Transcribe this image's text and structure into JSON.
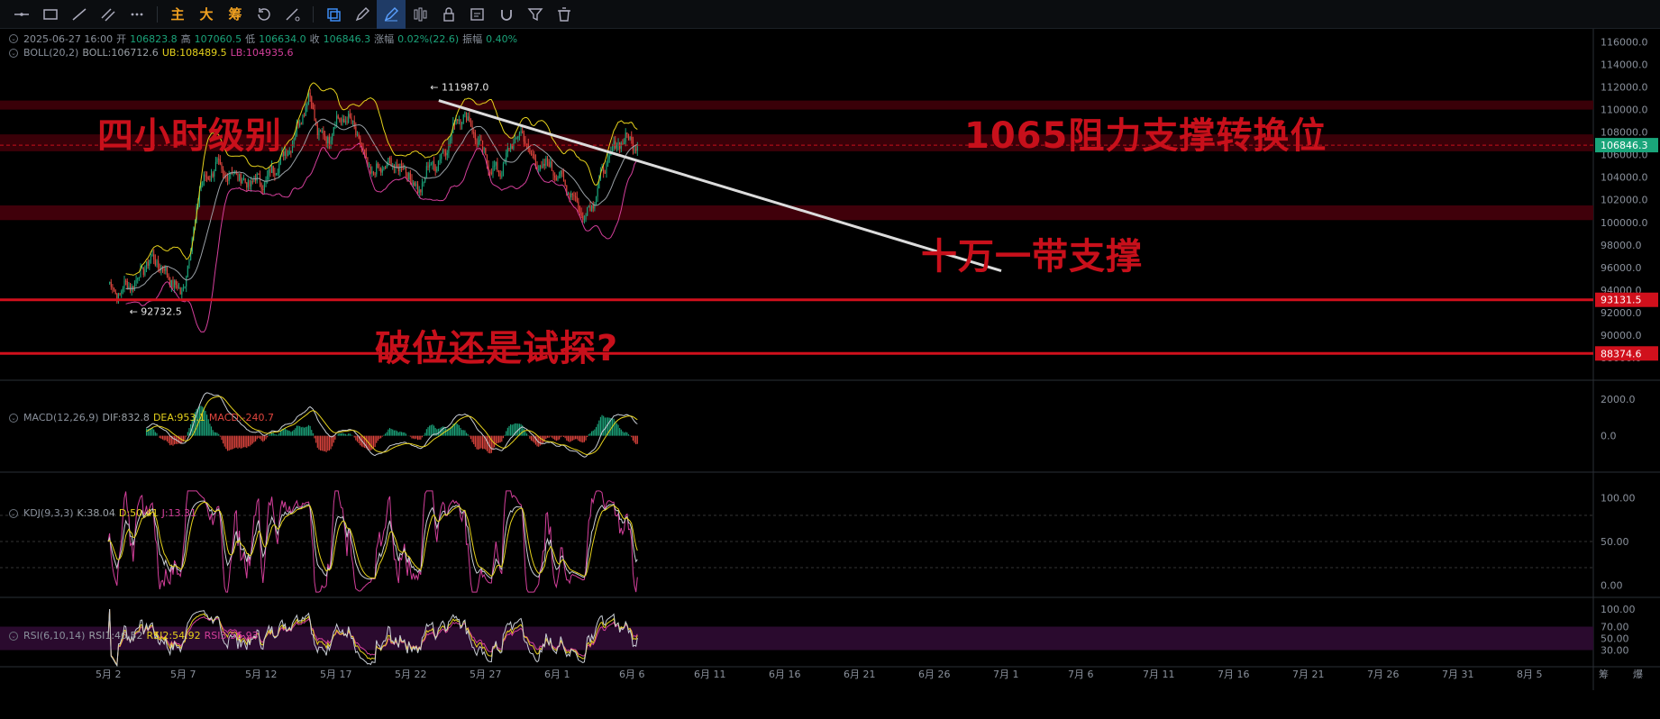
{
  "toolbar": {
    "tools": [
      "horizontal-line-icon",
      "rectangle-icon",
      "trend-line-icon",
      "parallel-line-icon",
      "more-icon"
    ],
    "text_buttons": [
      "主",
      "大",
      "筹"
    ],
    "right_tools": [
      "layers-icon",
      "pencil-icon",
      "pen-icon",
      "bars-icon",
      "lock-icon",
      "edit-icon",
      "magnet-icon",
      "filter-icon",
      "trash-icon"
    ]
  },
  "legends": {
    "main": {
      "date": "2025-06-27 16:00",
      "open_label": "开",
      "open": "106823.8",
      "high_label": "高",
      "high": "107060.5",
      "low_label": "低",
      "low": "106634.0",
      "close_label": "收",
      "close": "106846.3",
      "change_label": "涨幅",
      "change": "0.02%(22.6)",
      "amp_label": "振幅",
      "amp": "0.40%"
    },
    "boll": {
      "name": "BOLL(20,2)",
      "mid": "BOLL:106712.6",
      "ub": "UB:108489.5",
      "lb": "LB:104935.6"
    },
    "macd": {
      "name": "MACD(12,26,9)",
      "dif": "DIF:832.8",
      "dea": "DEA:953.1",
      "macd": "MACD:-240.7"
    },
    "kdj": {
      "name": "KDJ(9,3,3)",
      "k": "K:38.04",
      "d": "D:50.41",
      "j": "J:13.31"
    },
    "rsi": {
      "name": "RSI(6,10,14)",
      "rsi1": "RSI1:46.52",
      "rsi2": "RSI2:54.92",
      "rsi3": "RSI3:56.93"
    }
  },
  "annotations": {
    "title": "四小时级别",
    "resistance": "1065阻力支撑转换位",
    "support": "十万一带支撑",
    "question": "破位还是试探?"
  },
  "chart_data": {
    "type": "candlestick",
    "symbol_interval": "4h",
    "price_axis": {
      "min": 86000,
      "max": 117000,
      "ticks": [
        88000,
        90000,
        92000,
        94000,
        96000,
        98000,
        100000,
        102000,
        104000,
        106000,
        108000,
        110000,
        112000,
        114000,
        116000
      ],
      "tick_labels": [
        "88000.0",
        "90000.0",
        "92000.0",
        "94000.0",
        "96000.0",
        "98000.0",
        "100000.0",
        "102000.0",
        "104000.0",
        "106000.0",
        "108000.0",
        "110000.0",
        "112000.0",
        "114000.0",
        "116000.0"
      ]
    },
    "date_axis": {
      "labels": [
        "5月 2",
        "5月 7",
        "5月 12",
        "5月 17",
        "5月 22",
        "5月 27",
        "6月 1",
        "6月 6",
        "6月 11",
        "6月 16",
        "6月 21",
        "6月 26",
        "7月 1",
        "7月 6",
        "7月 11",
        "7月 16",
        "7月 21",
        "7月 26",
        "7月 31",
        "8月 5"
      ],
      "day_start": 1,
      "day_end": 36.5,
      "axis_day_end": 100,
      "corner": [
        "筹",
        "爆"
      ]
    },
    "anchors": [
      {
        "d": 0,
        "p": 94600
      },
      {
        "d": 1,
        "p": 93600
      },
      {
        "d": 2,
        "p": 94400
      },
      {
        "d": 3,
        "p": 94600
      },
      {
        "d": 4,
        "p": 96200
      },
      {
        "d": 5,
        "p": 96800
      },
      {
        "d": 6,
        "p": 95800
      },
      {
        "d": 7,
        "p": 94800
      },
      {
        "d": 8,
        "p": 93500
      },
      {
        "d": 9,
        "p": 97200
      },
      {
        "d": 10,
        "p": 103000
      },
      {
        "d": 11,
        "p": 104200
      },
      {
        "d": 12,
        "p": 105000
      },
      {
        "d": 13,
        "p": 104000
      },
      {
        "d": 14,
        "p": 104500
      },
      {
        "d": 15,
        "p": 103300
      },
      {
        "d": 16,
        "p": 103800
      },
      {
        "d": 17,
        "p": 103500
      },
      {
        "d": 18,
        "p": 104500
      },
      {
        "d": 19,
        "p": 105600
      },
      {
        "d": 20,
        "p": 106800
      },
      {
        "d": 21,
        "p": 109000
      },
      {
        "d": 22,
        "p": 111300
      },
      {
        "d": 23,
        "p": 108000
      },
      {
        "d": 24,
        "p": 107300
      },
      {
        "d": 25,
        "p": 109000
      },
      {
        "d": 26,
        "p": 109200
      },
      {
        "d": 27,
        "p": 108500
      },
      {
        "d": 28,
        "p": 105800
      },
      {
        "d": 29,
        "p": 104200
      },
      {
        "d": 30,
        "p": 104800
      },
      {
        "d": 31,
        "p": 105200
      },
      {
        "d": 32,
        "p": 104900
      },
      {
        "d": 33,
        "p": 104300
      },
      {
        "d": 34,
        "p": 102500
      },
      {
        "d": 35,
        "p": 104800
      },
      {
        "d": 36,
        "p": 105300
      },
      {
        "d": 37,
        "p": 106400
      },
      {
        "d": 38,
        "p": 108800
      },
      {
        "d": 39,
        "p": 109700
      },
      {
        "d": 40,
        "p": 108100
      },
      {
        "d": 41,
        "p": 106300
      },
      {
        "d": 42,
        "p": 104700
      },
      {
        "d": 43,
        "p": 104500
      },
      {
        "d": 44,
        "p": 106500
      },
      {
        "d": 45,
        "p": 108000
      },
      {
        "d": 46,
        "p": 106800
      },
      {
        "d": 47,
        "p": 104800
      },
      {
        "d": 48,
        "p": 105200
      },
      {
        "d": 49,
        "p": 104500
      },
      {
        "d": 50,
        "p": 103400
      },
      {
        "d": 51,
        "p": 102300
      },
      {
        "d": 52,
        "p": 100500
      },
      {
        "d": 53,
        "p": 101500
      },
      {
        "d": 54,
        "p": 104000
      },
      {
        "d": 55,
        "p": 106000
      },
      {
        "d": 56,
        "p": 107200
      },
      {
        "d": 57,
        "p": 107400
      },
      {
        "d": 58,
        "p": 106846
      }
    ],
    "anchor_day_start": 1,
    "anchor_day_step": 0.61,
    "extremes": [
      {
        "label": "111987.0",
        "price": 111987,
        "day": 22.4
      },
      {
        "label": "92732.5",
        "price": 92732.5,
        "day": 2.3
      }
    ],
    "zones": [
      {
        "from": 110000,
        "to": 110800,
        "color": "#3a0008"
      },
      {
        "from": 106300,
        "to": 107800,
        "color": "#3a0008"
      },
      {
        "from": 100200,
        "to": 101500,
        "color": "#40000a"
      }
    ],
    "h_lines": [
      {
        "price": 93131.5,
        "label": "93131.5",
        "color": "#d0101c"
      },
      {
        "price": 88374.6,
        "label": "88374.6",
        "color": "#d0101c"
      }
    ],
    "current_price": {
      "price": 106846.3,
      "label": "106846.3",
      "color": "#1aa57a"
    },
    "trend_line": {
      "from": {
        "day": 23.1,
        "price": 110800
      },
      "to": {
        "day": 60.7,
        "price": 95700
      },
      "color": "#dcdcdc"
    },
    "macd_axis": {
      "ticks": [
        2000,
        0
      ],
      "tick_labels": [
        "2000.0",
        "0.0"
      ]
    },
    "kdj_axis": {
      "ticks": [
        100,
        50,
        0
      ],
      "tick_labels": [
        "100.00",
        "50.00",
        "0.00"
      ]
    },
    "rsi_axis": {
      "ticks": [
        100,
        70,
        50,
        30
      ],
      "tick_labels": [
        "100.00",
        "70.00",
        "50.00",
        "30.00"
      ]
    },
    "colors": {
      "up": "#1ba37a",
      "down": "#e0453e",
      "boll_mid": "#9aa0a6",
      "boll_ub": "#e6d21c",
      "boll_lb": "#d43f9b",
      "dif": "#c9ced6",
      "dea": "#e6d21c",
      "k": "#c9ced6",
      "d": "#e6d21c",
      "j": "#d43f9b",
      "rsi_band": "#2a0a2e"
    }
  }
}
